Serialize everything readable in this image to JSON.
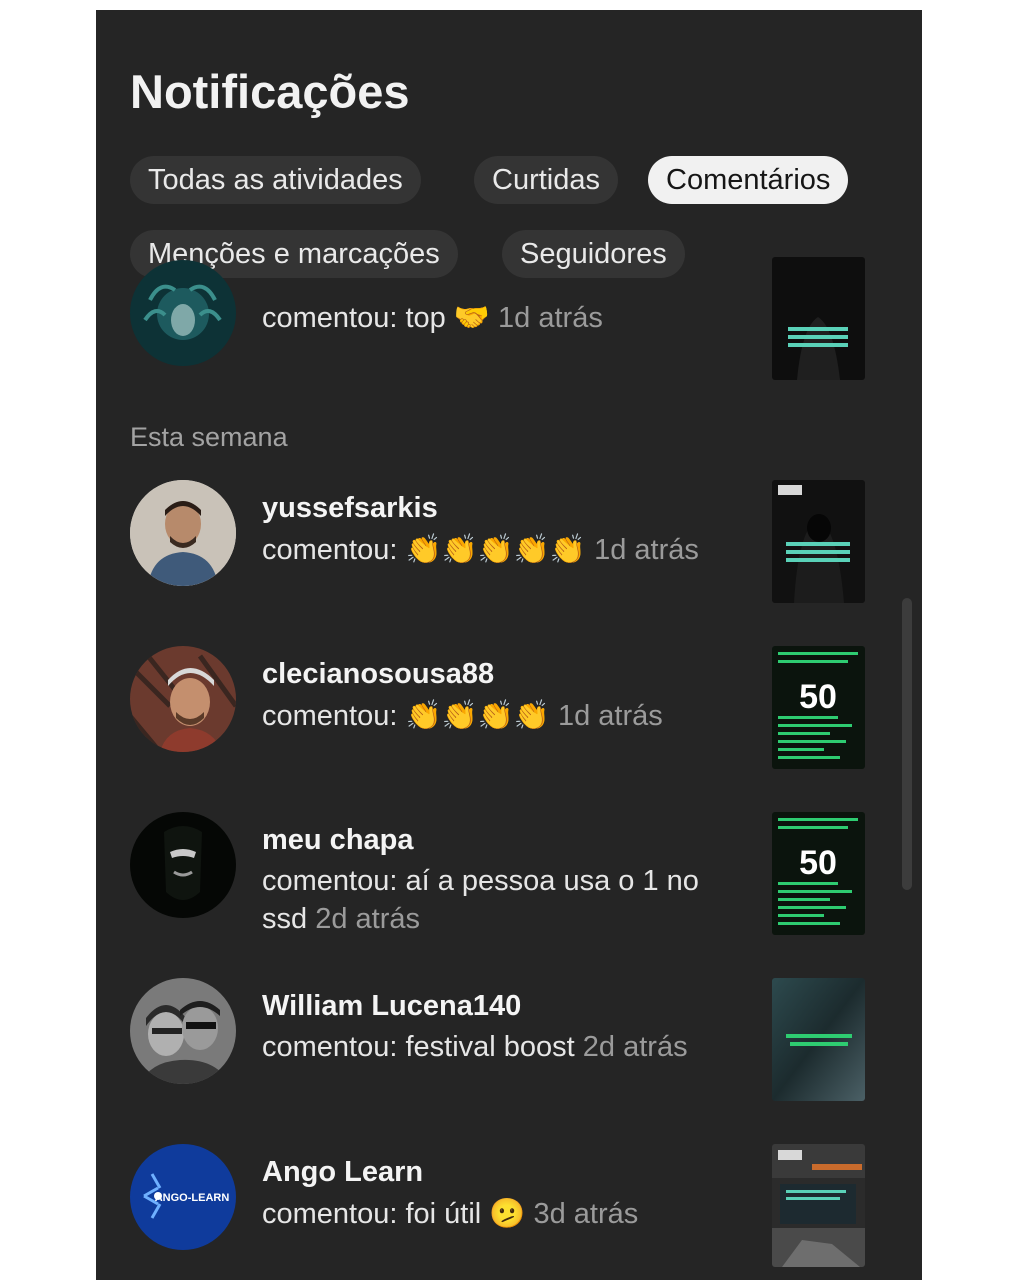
{
  "header": {
    "title": "Notificações"
  },
  "filters": [
    {
      "label": "Todas as atividades",
      "active": false
    },
    {
      "label": "Curtidas",
      "active": false
    },
    {
      "label": "Comentários",
      "active": true
    },
    {
      "label": "Menções e marcações",
      "active": false
    },
    {
      "label": "Seguidores",
      "active": false
    }
  ],
  "top_item": {
    "comment_prefix": "comentou: top",
    "emoji": "🤝",
    "time": "1d atrás"
  },
  "section_label": "Esta semana",
  "items": [
    {
      "username": "yussefsarkis",
      "comment_prefix": "comentou:",
      "emoji": "👏👏👏👏👏",
      "time": "1d atrás",
      "thumb_text": ""
    },
    {
      "username": "clecianosousa88",
      "comment_prefix": "comentou:",
      "emoji": "👏👏👏👏",
      "time": "1d atrás",
      "thumb_text": "50"
    },
    {
      "username": "meu chapa",
      "comment_prefix": "comentou: aí a pessoa usa o 1 no ssd",
      "emoji": "",
      "time": "2d atrás",
      "thumb_text": "50"
    },
    {
      "username": "William Lucena140",
      "comment_prefix": "comentou: festival boost",
      "emoji": "",
      "time": "2d atrás",
      "thumb_text": ""
    },
    {
      "username": "Ango Learn",
      "comment_prefix": "comentou: foi útil",
      "emoji": "🫤",
      "time": "3d atrás",
      "thumb_text": ""
    }
  ],
  "avatar_logo_text": "ANGO-LEARN",
  "colors": {
    "panel_bg": "#252525",
    "chip_bg": "#343434",
    "chip_active_bg": "#f1f1f1",
    "muted_text": "#9b9b9b",
    "thumb_accent_green": "#2ecc71",
    "thumb_accent_teal": "#5ad1b8"
  },
  "icons": {
    "avatar_top": "profile-photo-icon",
    "thumb": "post-thumbnail-icon"
  }
}
